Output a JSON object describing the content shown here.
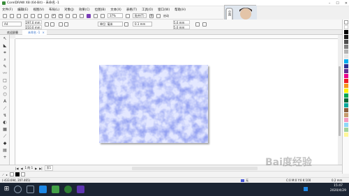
{
  "window": {
    "title": "CorelDRAW X8 (64-Bit) - 未命名 -1"
  },
  "menu": [
    "文件(F)",
    "编辑(E)",
    "视图(V)",
    "布局(L)",
    "对象(J)",
    "效果(C)",
    "位图(B)",
    "文本(X)",
    "表格(T)",
    "工具(O)",
    "窗口(W)",
    "帮助(H)"
  ],
  "toolbar": {
    "zoom": "37%",
    "snap_label": "贴齐(T)",
    "launch_label": "启动"
  },
  "props": {
    "page_size": "A4",
    "width": "297.0 mm",
    "height": "210.0 mm",
    "units": "单位: 毫米",
    "nudge": "0.1 mm",
    "dup_x": "5.0 mm",
    "dup_y": "5.0 mm"
  },
  "avatar": {
    "badge": "中国"
  },
  "tabs": [
    "欢迎屏幕",
    "未命名 -1"
  ],
  "pagenav": {
    "counter": "1 的 1",
    "page_label": "页1"
  },
  "status": {
    "coords": "(-433.694, 207.465)",
    "fill_label": "无",
    "color_info": "C:0 M:0 Y:0 K:100",
    "outline": "0.2 mm"
  },
  "taskbar": {
    "time": "15:47",
    "date": "2020/4/29"
  },
  "colors": {
    "accent": "#4b5bdb",
    "taskbar": "#1b2533"
  },
  "watermark": "Bai度经验"
}
